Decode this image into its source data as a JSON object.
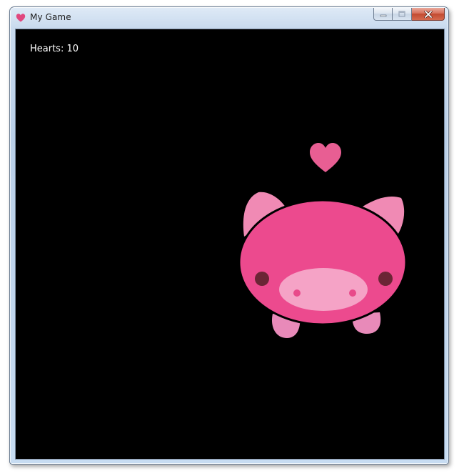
{
  "window": {
    "title": "My Game",
    "icon": "heart-icon"
  },
  "caption_buttons": {
    "minimize": "minimize-icon",
    "maximize": "maximize-icon",
    "close": "close-icon"
  },
  "hud": {
    "hearts_label": "Hearts: 10"
  },
  "sprites": {
    "player": "pig",
    "pickup": "heart"
  },
  "colors": {
    "background": "#000000",
    "pig_body": "#ec4a8e",
    "pig_ears": "#f08ab4",
    "pig_feet": "#e88ab9",
    "pig_snout": "#f5a3c6",
    "pig_nostrils": "#e84a8a",
    "pig_eyes": "#6b2535",
    "heart": "#e85e93",
    "title_icon": "#e0477e"
  }
}
